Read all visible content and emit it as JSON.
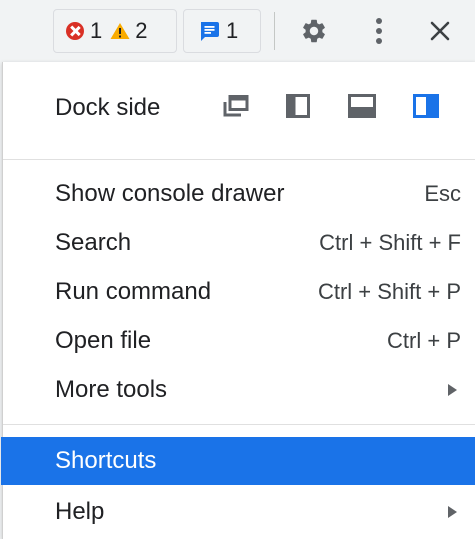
{
  "toolbar": {
    "error_count": "1",
    "warning_count": "2",
    "message_count": "1",
    "icons": {
      "error": "error-circle-icon",
      "warning": "warning-triangle-icon",
      "message": "message-icon",
      "settings": "gear-icon",
      "more": "kebab-menu-icon",
      "close": "close-icon"
    }
  },
  "menu": {
    "dock_side_label": "Dock side",
    "dock_options": [
      "undock-into-separate-window",
      "dock-to-left",
      "dock-to-bottom",
      "dock-to-right"
    ],
    "dock_selected": "dock-to-right",
    "items": [
      {
        "label": "Show console drawer",
        "shortcut": "Esc"
      },
      {
        "label": "Search",
        "shortcut": "Ctrl + Shift + F"
      },
      {
        "label": "Run command",
        "shortcut": "Ctrl + Shift + P"
      },
      {
        "label": "Open file",
        "shortcut": "Ctrl + P"
      },
      {
        "label": "More tools",
        "submenu": true
      }
    ],
    "shortcuts_label": "Shortcuts",
    "help_label": "Help"
  },
  "colors": {
    "accent": "#1a73e8",
    "error": "#d93025",
    "warning": "#f9ab00",
    "icon_gray": "#5f6368"
  }
}
